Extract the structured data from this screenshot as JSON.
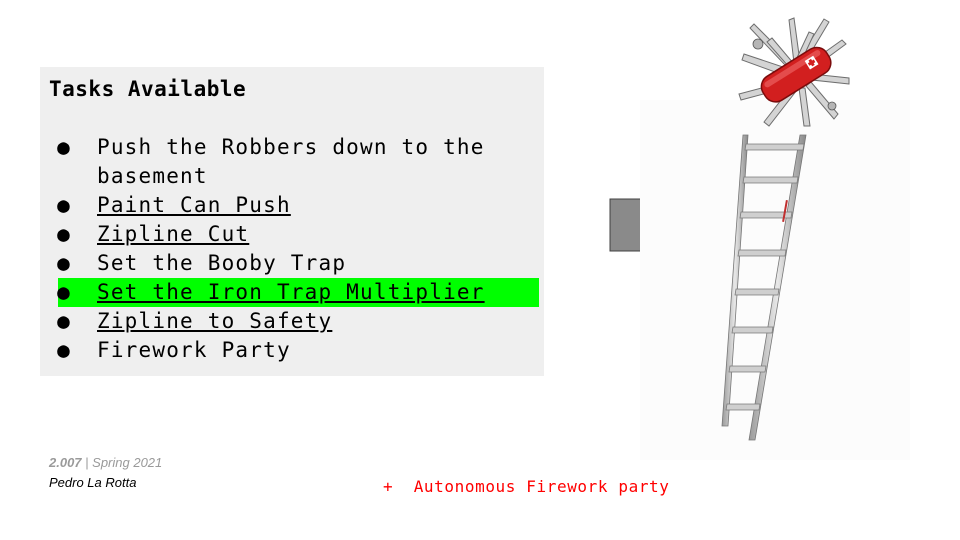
{
  "panel": {
    "title": "Tasks Available",
    "items": [
      {
        "text": "Push the Robbers down to the basement",
        "link": false,
        "highlight": false
      },
      {
        "text": "Paint Can Push",
        "link": true,
        "highlight": false
      },
      {
        "text": "Zipline Cut",
        "link": true,
        "highlight": false
      },
      {
        "text": "Set the Booby Trap",
        "link": false,
        "highlight": false
      },
      {
        "text": "Set the Iron Trap Multiplier",
        "link": true,
        "highlight": true
      },
      {
        "text": "Zipline to Safety",
        "link": true,
        "highlight": false
      },
      {
        "text": "Firework Party",
        "link": false,
        "highlight": false
      }
    ],
    "bullet": "●",
    "highlight_color": "#00ff00"
  },
  "footer": {
    "course_code": "2.007",
    "course_sep": " | ",
    "course_term": "Spring 2021",
    "author": "Pedro La Rotta",
    "note": "+  Autonomous Firework party"
  },
  "icons": {
    "arrow": "right-arrow-icon",
    "knife": "swiss-army-knife",
    "ladder": "aluminum-ladder"
  },
  "colors": {
    "panel_bg": "#efefef",
    "note": "#ff0000",
    "arrow_fill": "#8a8a8a"
  }
}
